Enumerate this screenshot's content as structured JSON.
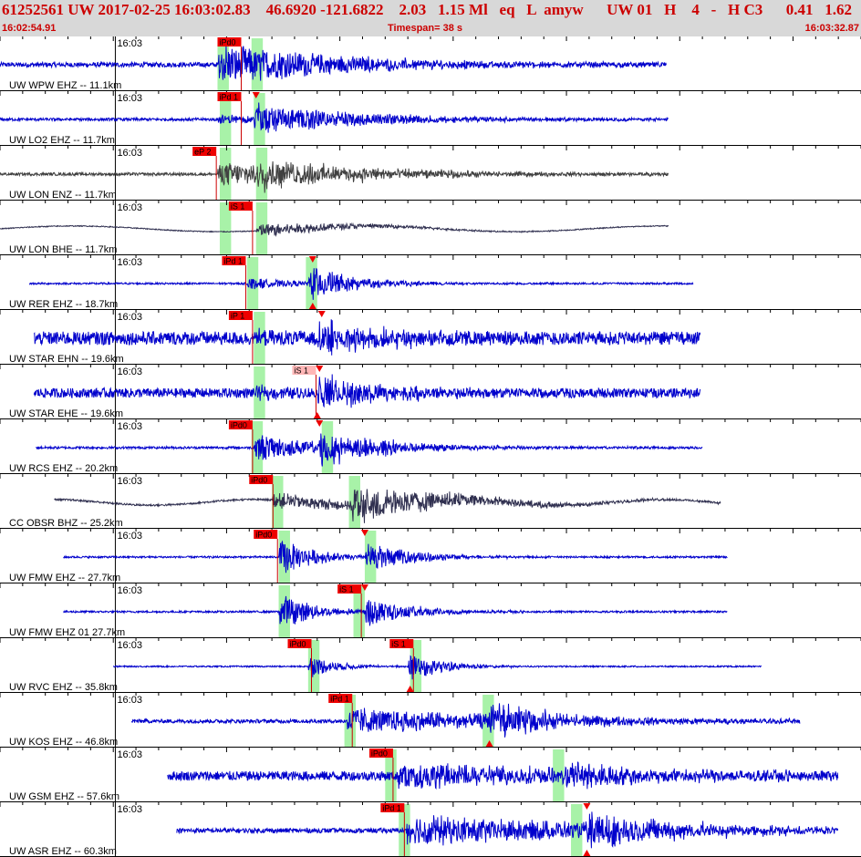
{
  "header": {
    "line": "61252561 UW 2017-02-25 16:03:02.83    46.6920 -121.6822    2.03   1.15 Ml   eq   L  amyw      UW 01   H    4   -   H C3      0.41   1.62",
    "start_time": "16:02:54.91",
    "timespan": "Timespan=  38 s",
    "end_time": "16:03:32.87"
  },
  "colors": {
    "background": "#ffffff",
    "header_bg": "#d8d8d8",
    "header_text": "#cc0000",
    "trace_vertical": "#0000cc",
    "trace_horizontal": "#404040",
    "trace_broadband": "#303050",
    "pick_red": "#ee0000",
    "pick_light": "#ffb6b6",
    "window_green": "#99f099",
    "tick": "#000000"
  },
  "chart_data": {
    "type": "seismogram",
    "time_axis": {
      "start": "16:02:54.91",
      "end": "16:03:32.87",
      "span_s": 38,
      "minute_tick_label": "16:03"
    },
    "traces": [
      {
        "label": "UW WPW EHZ -- 11.1km",
        "color": "blue",
        "start": 0.0,
        "end": 29.4,
        "noise": 0.1,
        "events": [
          {
            "t": 9.6,
            "amp": 1.0,
            "decay": 5.5
          }
        ],
        "picks": [
          {
            "label": "iPd0",
            "t": 9.6,
            "style": "red"
          }
        ],
        "windows": [
          [
            9.6,
            10.1
          ],
          [
            11.1,
            11.6
          ]
        ],
        "markers": []
      },
      {
        "label": "UW LO2 EHZ -- 11.7km",
        "color": "blue",
        "start": 0.0,
        "end": 29.5,
        "noise": 0.06,
        "events": [
          {
            "t": 9.6,
            "amp": 0.25,
            "decay": 2.0
          },
          {
            "t": 11.2,
            "amp": 0.7,
            "decay": 5
          }
        ],
        "picks": [
          {
            "label": "iPd 1",
            "t": 9.6,
            "style": "red"
          }
        ],
        "windows": [
          [
            9.7,
            10.2
          ],
          [
            11.2,
            11.7
          ]
        ],
        "markers": [
          {
            "t": 11.3,
            "pos": "top"
          }
        ]
      },
      {
        "label": "UW LON ENZ -- 11.7km",
        "color": "gray",
        "start": 0.0,
        "end": 29.5,
        "noise": 0.06,
        "events": [
          {
            "t": 9.6,
            "amp": 0.55,
            "decay": 6
          },
          {
            "t": 11.3,
            "amp": 0.55,
            "decay": 5
          }
        ],
        "picks": [
          {
            "label": "eP 2",
            "t": 8.5,
            "style": "red"
          }
        ],
        "windows": [
          [
            9.7,
            10.2
          ],
          [
            11.3,
            11.8
          ]
        ],
        "markers": []
      },
      {
        "label": "UW LON BHE -- 11.7km",
        "color": "dark",
        "start": 0.0,
        "end": 29.5,
        "noise": 0.02,
        "wave": {
          "amp": 0.12,
          "period": 13
        },
        "events": [
          {
            "t": 11.3,
            "amp": 0.35,
            "decay": 4
          }
        ],
        "picks": [
          {
            "label": "iS 1",
            "t": 10.1,
            "style": "red"
          }
        ],
        "windows": [
          [
            9.7,
            10.2
          ],
          [
            11.3,
            11.8
          ]
        ],
        "markers": []
      },
      {
        "label": "UW RER EHZ -- 18.7km",
        "color": "blue",
        "start": 1.3,
        "end": 30.6,
        "noise": 0.04,
        "events": [
          {
            "t": 10.9,
            "amp": 0.3,
            "decay": 2.0
          },
          {
            "t": 13.6,
            "amp": 0.85,
            "decay": 2.0
          }
        ],
        "picks": [
          {
            "label": "iPd 1",
            "t": 9.8,
            "style": "red"
          }
        ],
        "windows": [
          [
            10.9,
            11.4
          ],
          [
            13.5,
            14.0
          ]
        ],
        "markers": [
          {
            "t": 13.8,
            "pos": "both"
          }
        ]
      },
      {
        "label": "UW STAR EHN -- 19.6km",
        "color": "blue",
        "start": 1.5,
        "end": 30.9,
        "noise": 0.28,
        "events": [
          {
            "t": 11.3,
            "amp": 0.2,
            "decay": 2
          },
          {
            "t": 14.0,
            "amp": 0.8,
            "decay": 3
          }
        ],
        "picks": [
          {
            "label": "iP 1",
            "t": 10.1,
            "style": "red"
          }
        ],
        "windows": [
          [
            11.2,
            11.7
          ]
        ],
        "markers": [
          {
            "t": 14.2,
            "pos": "top"
          }
        ]
      },
      {
        "label": "UW STAR EHE -- 19.6km",
        "color": "blue",
        "start": 1.5,
        "end": 30.9,
        "noise": 0.2,
        "events": [
          {
            "t": 11.3,
            "amp": 0.25,
            "decay": 2
          },
          {
            "t": 14.0,
            "amp": 0.8,
            "decay": 3
          }
        ],
        "picks": [
          {
            "label": "iS 1",
            "t": 12.9,
            "style": "light"
          }
        ],
        "windows": [
          [
            11.2,
            11.7
          ]
        ],
        "markers": [
          {
            "t": 14.1,
            "pos": "top"
          },
          {
            "t": 14.0,
            "pos": "bottom"
          }
        ]
      },
      {
        "label": "UW RCS EHZ -- 20.2km",
        "color": "blue",
        "start": 1.6,
        "end": 31.0,
        "noise": 0.05,
        "events": [
          {
            "t": 11.2,
            "amp": 0.65,
            "decay": 3
          },
          {
            "t": 14.0,
            "amp": 0.8,
            "decay": 3
          }
        ],
        "picks": [
          {
            "label": "iPd0",
            "t": 10.1,
            "style": "red"
          }
        ],
        "windows": [
          [
            11.1,
            11.6
          ],
          [
            14.2,
            14.7
          ]
        ],
        "markers": [
          {
            "t": 14.1,
            "pos": "top"
          }
        ]
      },
      {
        "label": "CC OBSR BHZ -- 25.2km",
        "color": "dark",
        "start": 2.4,
        "end": 31.8,
        "noise": 0.04,
        "wave": {
          "amp": 0.12,
          "period": 9
        },
        "events": [
          {
            "t": 12.0,
            "amp": 0.35,
            "decay": 6
          },
          {
            "t": 15.5,
            "amp": 0.9,
            "decay": 4
          }
        ],
        "picks": [
          {
            "label": "iPd0",
            "t": 11.0,
            "style": "red"
          }
        ],
        "windows": [
          [
            12.0,
            12.5
          ],
          [
            15.4,
            15.9
          ]
        ],
        "markers": []
      },
      {
        "label": "UW FMW EHZ -- 27.7km",
        "color": "blue",
        "start": 2.8,
        "end": 32.1,
        "noise": 0.04,
        "events": [
          {
            "t": 12.3,
            "amp": 0.9,
            "decay": 1.5
          },
          {
            "t": 16.1,
            "amp": 0.75,
            "decay": 2
          }
        ],
        "picks": [
          {
            "label": "iPd0",
            "t": 11.2,
            "style": "red"
          }
        ],
        "windows": [
          [
            12.3,
            12.8
          ],
          [
            16.1,
            16.6
          ]
        ],
        "markers": [
          {
            "t": 16.1,
            "pos": "top"
          }
        ]
      },
      {
        "label": "UW FMW EHZ 01 27.7km",
        "color": "blue",
        "start": 2.8,
        "end": 32.1,
        "noise": 0.04,
        "events": [
          {
            "t": 12.3,
            "amp": 0.9,
            "decay": 1.5
          },
          {
            "t": 16.1,
            "amp": 0.75,
            "decay": 2
          }
        ],
        "picks": [
          {
            "label": "iS 1",
            "t": 14.9,
            "style": "red"
          }
        ],
        "windows": [
          [
            12.3,
            12.8
          ],
          [
            15.6,
            16.1
          ]
        ],
        "markers": [
          {
            "t": 16.1,
            "pos": "top"
          }
        ]
      },
      {
        "label": "UW RVC EHZ -- 35.8km",
        "color": "blue",
        "start": 5.0,
        "end": 33.6,
        "noise": 0.03,
        "events": [
          {
            "t": 13.6,
            "amp": 0.55,
            "decay": 1.2
          },
          {
            "t": 18.0,
            "amp": 0.75,
            "decay": 1.5
          }
        ],
        "picks": [
          {
            "label": "iPd0",
            "t": 12.7,
            "style": "red"
          },
          {
            "label": "iS 1",
            "t": 17.2,
            "style": "red"
          }
        ],
        "windows": [
          [
            13.6,
            14.1
          ],
          [
            18.1,
            18.6
          ]
        ],
        "markers": [
          {
            "t": 18.1,
            "pos": "bottom"
          }
        ]
      },
      {
        "label": "UW KOS EHZ -- 46.8km",
        "color": "blue",
        "start": 5.8,
        "end": 35.3,
        "noise": 0.08,
        "events": [
          {
            "t": 15.3,
            "amp": 0.6,
            "decay": 8
          },
          {
            "t": 21.5,
            "amp": 0.8,
            "decay": 3
          }
        ],
        "picks": [
          {
            "label": "iPd 1",
            "t": 14.5,
            "style": "red"
          }
        ],
        "windows": [
          [
            15.2,
            15.7
          ],
          [
            21.3,
            21.8
          ]
        ],
        "markers": [
          {
            "t": 21.6,
            "pos": "bottom"
          }
        ]
      },
      {
        "label": "UW GSM EHZ -- 57.6km",
        "color": "blue",
        "start": 7.4,
        "end": 37.0,
        "noise": 0.2,
        "events": [
          {
            "t": 17.5,
            "amp": 0.6,
            "decay": 8
          },
          {
            "t": 24.8,
            "amp": 0.7,
            "decay": 3
          }
        ],
        "picks": [
          {
            "label": "iPd0",
            "t": 16.3,
            "style": "red"
          }
        ],
        "windows": [
          [
            17.0,
            17.5
          ],
          [
            24.4,
            24.9
          ]
        ],
        "markers": []
      },
      {
        "label": "UW ASR EHZ -- 60.3km",
        "color": "blue",
        "start": 7.8,
        "end": 37.0,
        "noise": 0.1,
        "events": [
          {
            "t": 17.9,
            "amp": 0.7,
            "decay": 10
          },
          {
            "t": 25.9,
            "amp": 0.8,
            "decay": 4
          }
        ],
        "picks": [
          {
            "label": "iPd 1",
            "t": 16.8,
            "style": "red"
          }
        ],
        "windows": [
          [
            17.6,
            18.1
          ],
          [
            25.2,
            25.7
          ]
        ],
        "markers": [
          {
            "t": 25.9,
            "pos": "top"
          },
          {
            "t": 25.9,
            "pos": "bottom"
          }
        ]
      }
    ]
  }
}
